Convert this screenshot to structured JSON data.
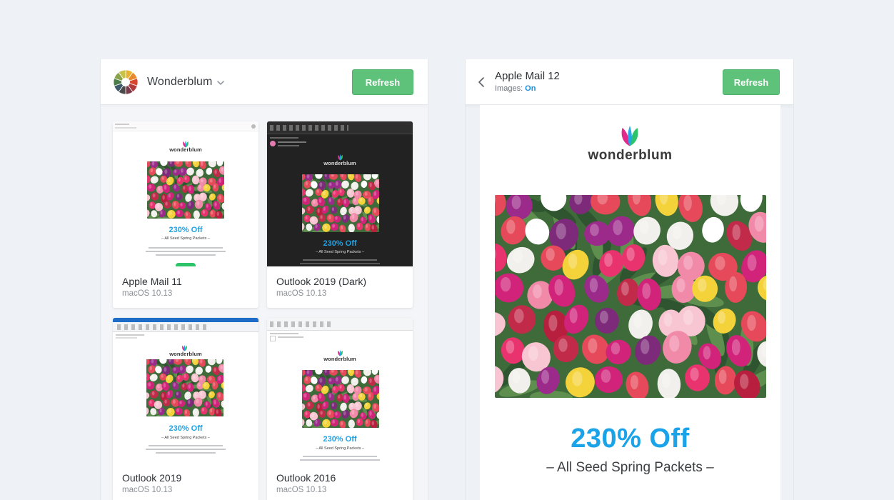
{
  "left": {
    "brand_name": "Wonderblum",
    "refresh_label": "Refresh",
    "cards": [
      {
        "title": "Apple Mail 11",
        "subtitle": "macOS 10.13",
        "theme": "light",
        "headline": "230% Off",
        "subline": "– All Seed Spring Packets –",
        "brand": "wonderblum"
      },
      {
        "title": "Outlook 2019 (Dark)",
        "subtitle": "macOS 10.13",
        "theme": "dark",
        "headline": "230% Off",
        "subline": "– All Seed Spring Packets –",
        "brand": "wonderblum"
      },
      {
        "title": "Outlook 2019",
        "subtitle": "macOS 10.13",
        "theme": "light",
        "headline": "230% Off",
        "subline": "– All Seed Spring Packets –",
        "brand": "wonderblum"
      },
      {
        "title": "Outlook 2016",
        "subtitle": "macOS 10.13",
        "theme": "light",
        "headline": "230% Off",
        "subline": "– All Seed Spring Packets –",
        "brand": "wonderblum"
      }
    ]
  },
  "right": {
    "client_title": "Apple Mail 12",
    "images_label": "Images:",
    "images_value": "On",
    "refresh_label": "Refresh",
    "email": {
      "brand": "wonderblum",
      "headline": "230% Off",
      "subline": "– All Seed Spring Packets –"
    }
  },
  "colors": {
    "accent_green": "#5ec27a",
    "headline_blue": "#1aa3e8",
    "link_blue": "#1a8ee0"
  },
  "icons": [
    "wonderblum-color-wheel-icon",
    "chevron-down-icon",
    "back-arrow-icon",
    "tulip-logo-icon"
  ]
}
